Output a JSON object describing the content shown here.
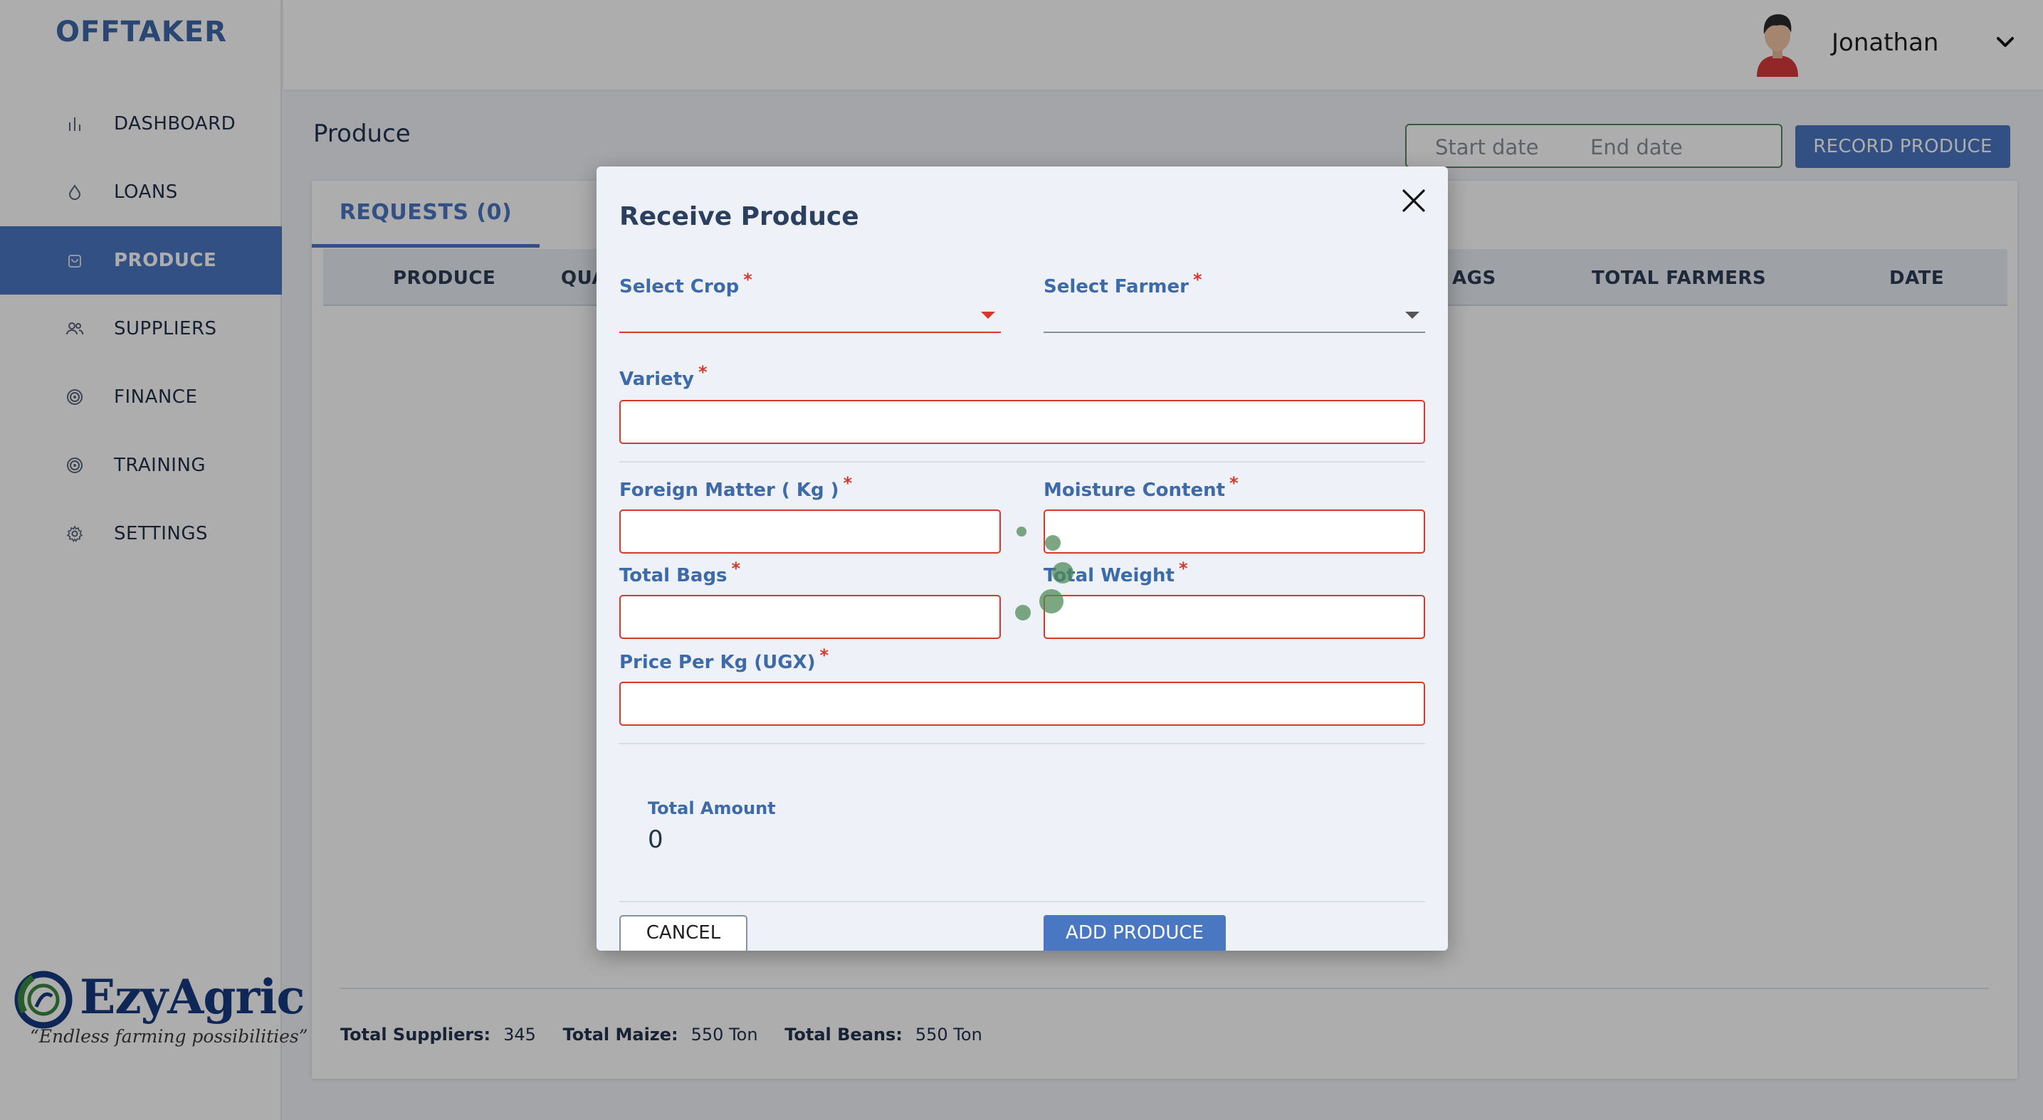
{
  "brand": "OFFTAKER",
  "sidebar": {
    "items": [
      {
        "label": "DASHBOARD",
        "icon": "bar-chart-icon"
      },
      {
        "label": "LOANS",
        "icon": "drop-icon"
      },
      {
        "label": "PRODUCE",
        "icon": "bag-icon",
        "active": true
      },
      {
        "label": "SUPPLIERS",
        "icon": "users-icon"
      },
      {
        "label": "FINANCE",
        "icon": "target-icon"
      },
      {
        "label": "TRAINING",
        "icon": "target-icon"
      },
      {
        "label": "SETTINGS",
        "icon": "gear-icon"
      }
    ],
    "logo": {
      "name": "EzyAgric",
      "tagline": "“Endless farming possibilities”"
    }
  },
  "header": {
    "user_name": "Jonathan"
  },
  "page": {
    "title": "Produce",
    "start_date_placeholder": "Start date",
    "end_date_placeholder": "End date",
    "record_button": "RECORD PRODUCE"
  },
  "tabs": [
    {
      "label": "REQUESTS (0)"
    }
  ],
  "table": {
    "columns": [
      "PRODUCE",
      "QUA",
      "AGS",
      "TOTAL FARMERS",
      "DATE"
    ]
  },
  "footer": {
    "suppliers_label": "Total Suppliers:",
    "suppliers_value": "345",
    "maize_label": "Total Maize:",
    "maize_value": "550 Ton",
    "beans_label": "Total Beans:",
    "beans_value": "550 Ton"
  },
  "modal": {
    "title": "Receive Produce",
    "required_mark": "*",
    "fields": {
      "crop": "Select Crop",
      "farmer": "Select Farmer",
      "variety": "Variety",
      "foreign_matter": "Foreign Matter ( Kg )",
      "moisture": "Moisture Content",
      "bags": "Total Bags",
      "weight": "Total Weight",
      "price": "Price Per Kg (UGX)"
    },
    "total_label": "Total Amount",
    "total_value": "0",
    "cancel": "CANCEL",
    "add": "ADD PRODUCE"
  },
  "colors": {
    "accent": "#4a77c1",
    "label": "#3d6aa8",
    "error": "#d33a2c",
    "date_border": "#4f8a5a"
  }
}
